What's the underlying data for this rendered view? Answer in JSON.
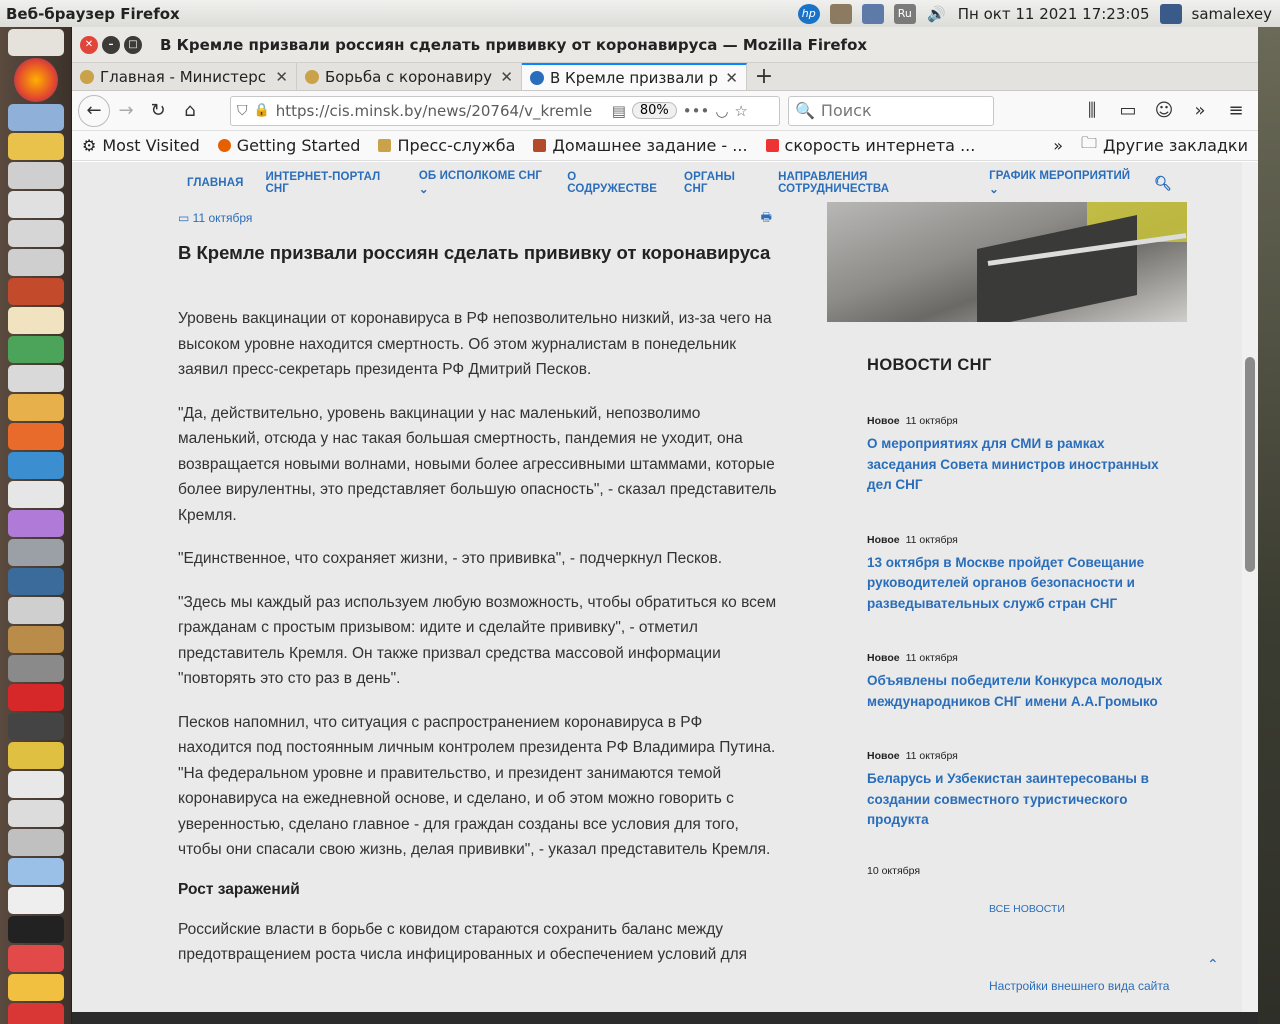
{
  "panel": {
    "app_title": "Веб-браузер Firefox",
    "clock": "Пн окт 11 2021 17:23:05",
    "keyboard_layout": "Ru",
    "user": "samalexey"
  },
  "window": {
    "title": "В Кремле призвали россиян сделать прививку от коронавируса — Mozilla Firefox"
  },
  "tabs": [
    {
      "label": "Главная - Министерс",
      "close": "✕"
    },
    {
      "label": "Борьба с коронавиру",
      "close": "✕"
    },
    {
      "label": "В Кремле призвали р",
      "close": "✕"
    }
  ],
  "toolbar": {
    "url": "https://cis.minsk.by/news/20764/v_kremle",
    "zoom": "80%",
    "search_placeholder": "Поиск"
  },
  "bookmarks": [
    {
      "label": "Most Visited"
    },
    {
      "label": "Getting Started"
    },
    {
      "label": "Пресс-служба"
    },
    {
      "label": "Домашнее задание - ..."
    },
    {
      "label": "скорость интернета ..."
    }
  ],
  "bookmarks_other": "Другие закладки",
  "sitenav": [
    {
      "label": "ГЛАВНАЯ"
    },
    {
      "label": "ИНТЕРНЕТ-ПОРТАЛ СНГ"
    },
    {
      "label": "ОБ ИСПОЛКОМЕ СНГ ⌄"
    },
    {
      "label": "О СОДРУЖЕСТВЕ"
    },
    {
      "label": "ОРГАНЫ СНГ"
    },
    {
      "label": "НАПРАВЛЕНИЯ СОТРУДНИЧЕСТВА"
    },
    {
      "label": "ГРАФИК МЕРОПРИЯТИЙ ⌄"
    }
  ],
  "article": {
    "date": "11 октября",
    "title": "В Кремле призвали россиян сделать прививку от коронавируса",
    "p1": "Уровень вакцинации от коронавируса в РФ непозволительно низкий, из-за чего на высоком уровне находится смертность. Об этом журналистам в понедельник заявил пресс-секретарь президента РФ Дмитрий Песков.",
    "p2": "\"Да, действительно, уровень вакцинации у нас маленький, непозволимо маленький, отсюда у нас такая большая смертность, пандемия не уходит, она возвращается новыми волнами, новыми более агрессивными штаммами, которые более вирулентны, это представляет большую опасность\", - сказал представитель Кремля.",
    "p3": "\"Единственное, что сохраняет жизни, - это прививка\", - подчеркнул Песков.",
    "p4": "\"Здесь мы каждый раз используем любую возможность, чтобы обратиться ко всем гражданам с простым призывом: идите и сделайте прививку\", - отметил представитель Кремля. Он также призвал средства массовой информации \"повторять это сто раз в день\".",
    "p5": "Песков напомнил, что ситуация с распространением коронавируса в РФ находится под постоянным личным контролем президента РФ Владимира Путина. \"На федеральном уровне и правительство, и президент занимаются темой коронавируса на ежедневной основе, и сделано, и об этом можно говорить с уверенностью, сделано главное - для граждан созданы все условия для того, чтобы они спасали свою жизнь, делая прививки\", - указал представитель Кремля.",
    "subheading": "Рост заражений",
    "p6": "Российские власти в борьбе с ковидом стараются сохранить баланс между предотвращением роста числа инфицированных и обеспечением условий для"
  },
  "sidebar": {
    "heading": "НОВОСТИ СНГ",
    "items": [
      {
        "badge": "Новое",
        "date": "11 октября",
        "title": "О мероприятиях для СМИ в рамках заседания Совета министров иностранных дел СНГ"
      },
      {
        "badge": "Новое",
        "date": "11 октября",
        "title": "13 октября в Москве пройдет Совещание руководителей органов безопасности и разведывательных служб стран СНГ"
      },
      {
        "badge": "Новое",
        "date": "11 октября",
        "title": "Объявлены победители Конкурса молодых международников СНГ имени А.А.Громыко"
      },
      {
        "badge": "Новое",
        "date": "11 октября",
        "title": "Беларусь и Узбекистан заинтересованы в создании совместного туристического продукта"
      }
    ],
    "date_only": "10 октября",
    "all_news": "ВСЕ НОВОСТИ",
    "settings": "Настройки внешнего вида сайта"
  }
}
